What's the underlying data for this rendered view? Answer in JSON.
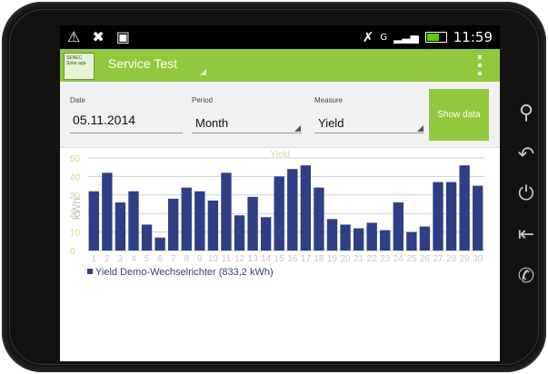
{
  "status_bar": {
    "left_icons": [
      "warning-icon",
      "tools-icon",
      "briefcase-icon"
    ],
    "left_glyphs": "⚠ ✖ ▣",
    "right_icons": [
      "no-signal-icon",
      "data-g-icon",
      "signal-bars-icon",
      "battery-icon"
    ],
    "data_indicator": "G",
    "time": "11:59"
  },
  "action_bar": {
    "title": "Service Test",
    "logo_text": "SENEC Solar app",
    "overflow_icon": "overflow-menu-icon",
    "background": "#92c83e"
  },
  "controls": {
    "date_label": "Date",
    "date_value": "05.11.2014",
    "period_label": "Period",
    "period_value": "Month",
    "measure_label": "Measure",
    "measure_value": "Yield",
    "show_button": "Show data"
  },
  "nav_buttons": [
    "search-icon",
    "back-icon",
    "power-icon",
    "exit-icon",
    "phone-icon"
  ],
  "chart_data": {
    "type": "bar",
    "title": "Yield",
    "ylabel": "kWh",
    "ylim": [
      0,
      50
    ],
    "yticks": [
      0,
      10,
      20,
      30,
      40,
      50
    ],
    "categories": [
      "1",
      "2",
      "3",
      "4",
      "5",
      "6",
      "7",
      "8",
      "9",
      "10",
      "11",
      "12",
      "13",
      "14",
      "15",
      "16",
      "17",
      "18",
      "19",
      "20",
      "21",
      "22",
      "23",
      "24",
      "25",
      "26",
      "27",
      "28",
      "29",
      "30"
    ],
    "series": [
      {
        "name": "Yield Demo-Wechselrichter (833,2 kWh)",
        "color": "#2e3f86",
        "values": [
          32,
          42,
          26,
          32,
          14,
          7,
          28,
          34,
          32,
          27,
          42,
          19,
          29,
          18,
          40,
          44,
          46,
          34,
          17,
          14,
          12,
          15,
          11,
          26,
          10,
          13,
          37,
          37,
          46,
          35
        ]
      }
    ],
    "grid": true,
    "legend_position": "bottom-left"
  }
}
